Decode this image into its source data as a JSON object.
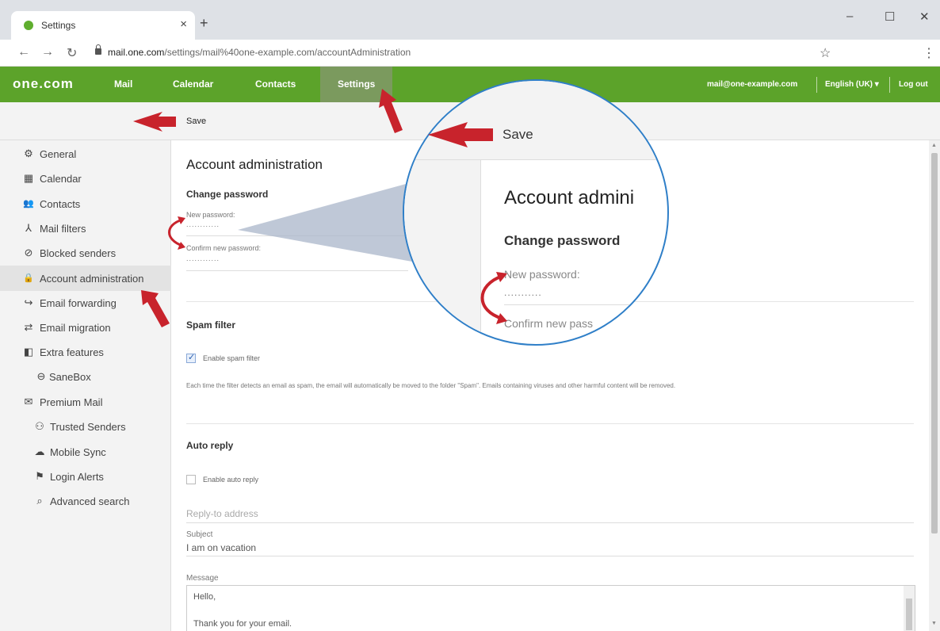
{
  "browser": {
    "tab_title": "Settings",
    "tab_close": "×",
    "new_tab": "+",
    "url_host": "mail.one.com",
    "url_path": "/settings/mail%40one-example.com/accountAdministration",
    "window_controls": [
      "–",
      "☐",
      "✕"
    ]
  },
  "app": {
    "logo": "one.com",
    "nav": [
      {
        "label": "Mail"
      },
      {
        "label": "Calendar"
      },
      {
        "label": "Contacts"
      },
      {
        "label": "Settings",
        "active": true
      }
    ],
    "user_email": "mail@one-example.com",
    "language": "English (UK) ▾",
    "logout": "Log out",
    "brand_color": "#5ca32a"
  },
  "toolbar": {
    "save_label": "Save"
  },
  "sidebar": {
    "items": [
      {
        "label": "General",
        "icon": "gear-icon",
        "glyph": "⚙"
      },
      {
        "label": "Calendar",
        "icon": "calendar-icon",
        "glyph": "▦"
      },
      {
        "label": "Contacts",
        "icon": "contacts-icon",
        "glyph": "👥"
      },
      {
        "label": "Mail filters",
        "icon": "filter-icon",
        "glyph": "⅄"
      },
      {
        "label": "Blocked senders",
        "icon": "blocked-icon",
        "glyph": "⊘"
      },
      {
        "label": "Account administration",
        "icon": "lock-icon",
        "glyph": "🔒",
        "active": true
      },
      {
        "label": "Email forwarding",
        "icon": "forward-icon",
        "glyph": "↪"
      },
      {
        "label": "Email migration",
        "icon": "migration-icon",
        "glyph": "⇄"
      },
      {
        "label": "Extra features",
        "icon": "box-icon",
        "glyph": "◧"
      },
      {
        "label": "SaneBox",
        "icon": "sanebox-icon",
        "glyph": "⊖",
        "sub": true
      },
      {
        "label": "Premium Mail",
        "icon": "premium-icon",
        "glyph": "✉"
      },
      {
        "label": "Trusted Senders",
        "icon": "trusted-icon",
        "glyph": "⚇",
        "sub": true
      },
      {
        "label": "Mobile Sync",
        "icon": "cloud-icon",
        "glyph": "☁",
        "sub": true
      },
      {
        "label": "Login Alerts",
        "icon": "alert-icon",
        "glyph": "⚑",
        "sub": true
      },
      {
        "label": "Advanced search",
        "icon": "search-icon",
        "glyph": "⌕",
        "sub": true
      }
    ]
  },
  "main": {
    "title": "Account administration",
    "change_password": {
      "heading": "Change password",
      "new_label": "New password:",
      "new_value": "............",
      "confirm_label": "Confirm new password:",
      "confirm_value": "............"
    },
    "spam": {
      "heading": "Spam filter",
      "checkbox_label": "Enable spam filter",
      "checked": true,
      "description": "Each time the filter detects an email as spam, the email will automatically be moved to the folder \"Spam\". Emails containing viruses and other harmful content will be removed."
    },
    "auto_reply": {
      "heading": "Auto reply",
      "checkbox_label": "Enable auto reply",
      "checked": false,
      "reply_to_placeholder": "Reply-to address",
      "subject_label": "Subject",
      "subject_value": "I am on vacation",
      "message_label": "Message",
      "message_lines": [
        "Hello,",
        "",
        "Thank you for your email."
      ]
    }
  },
  "magnifier": {
    "save": "Save",
    "title": "Account admini",
    "heading": "Change password",
    "new_label": "New password:",
    "new_value": "...........",
    "confirm_label": "Confirm new pass",
    "confirm_value": "..........."
  }
}
